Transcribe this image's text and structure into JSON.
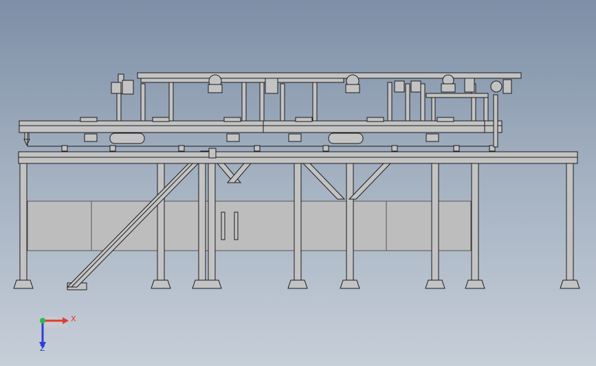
{
  "viewport": {
    "background_top": "#7d8fa6",
    "background_bottom": "#c6ced8",
    "model_fill": "#c3c3c3",
    "model_line": "#1a1a1a"
  },
  "triad": {
    "x_label": "X",
    "z_label": "Z",
    "x_color": "#e23b2e",
    "y_color": "#2db84a",
    "z_color": "#2d3fd4"
  }
}
